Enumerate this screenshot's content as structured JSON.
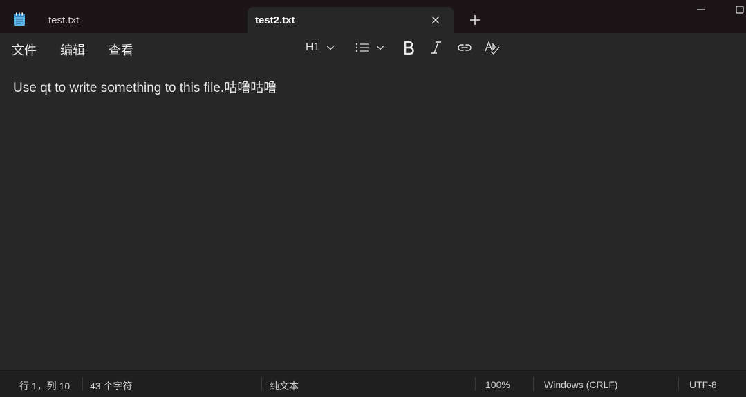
{
  "tabs": [
    {
      "label": "test.txt",
      "active": false
    },
    {
      "label": "test2.txt",
      "active": true
    }
  ],
  "menu": {
    "file": "文件",
    "edit": "编辑",
    "view": "查看"
  },
  "toolbar": {
    "heading": "H1"
  },
  "editor": {
    "content": "Use qt to write something to this file.咕噜咕噜"
  },
  "status": {
    "position": "行 1，列 10",
    "char_count": "43 个字符",
    "format": "纯文本",
    "zoom": "100%",
    "line_ending": "Windows (CRLF)",
    "encoding": "UTF-8"
  },
  "colors": {
    "titlebar": "#1c1518",
    "editor_bg": "#272727",
    "statusbar": "#1f1f1f",
    "app_icon": "#5ab4e8"
  },
  "icons": [
    "notepad-icon",
    "close-icon",
    "plus-icon",
    "minimize-icon",
    "maximize-icon",
    "chevron-down-icon",
    "list-icon",
    "bold-icon",
    "italic-icon",
    "link-icon",
    "spellcheck-icon"
  ]
}
